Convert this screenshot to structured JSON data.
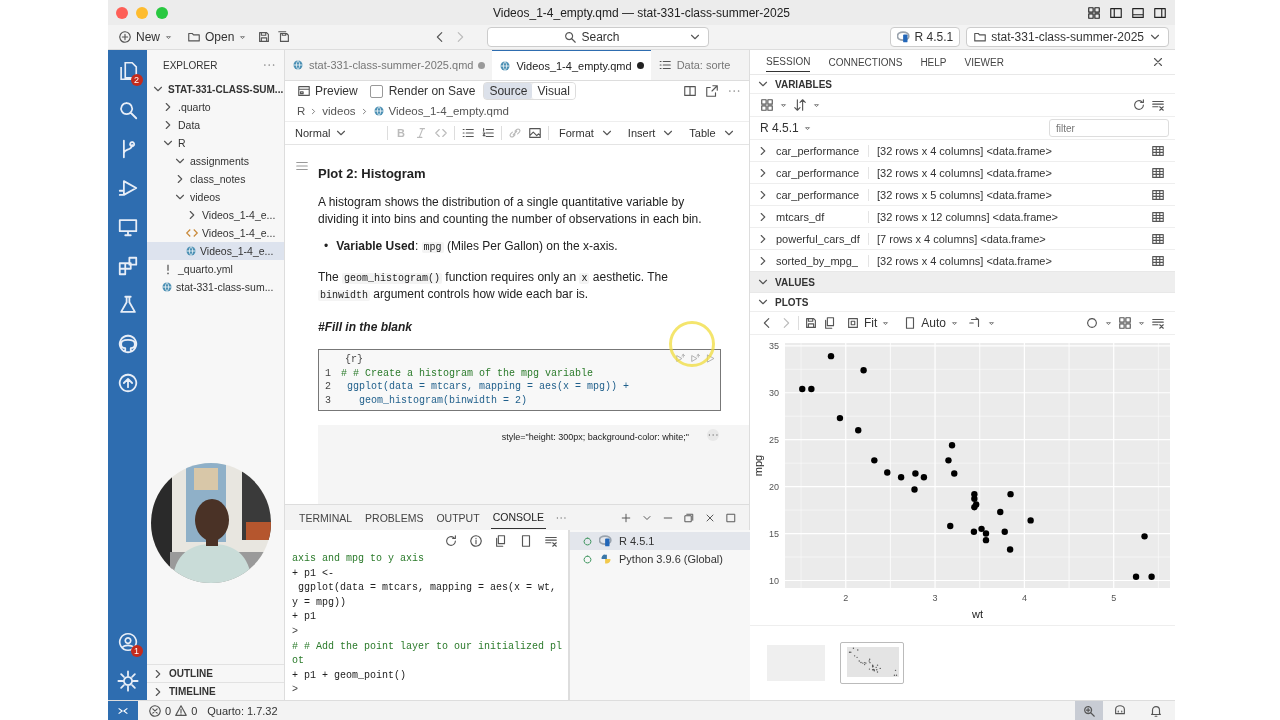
{
  "window": {
    "title": "Videos_1-4_empty.qmd — stat-331-class-summer-2025"
  },
  "toolbar": {
    "new": "New",
    "open": "Open",
    "search": "Search",
    "interpreter": "R 4.5.1",
    "project": "stat-331-class-summer-2025"
  },
  "activity_bar": {
    "explorer_badge": "2",
    "accounts_badge": "1"
  },
  "explorer": {
    "title": "EXPLORER",
    "root": "STAT-331-CLASS-SUM...",
    "tree": [
      {
        "label": ".quarto",
        "kind": "folder",
        "expanded": false,
        "selected": false
      },
      {
        "label": "Data",
        "kind": "folder",
        "expanded": false,
        "selected": false
      },
      {
        "label": "R",
        "kind": "folder",
        "expanded": true,
        "selected": false,
        "children": [
          {
            "label": "assignments",
            "kind": "folder",
            "expanded": true,
            "selected": false
          },
          {
            "label": "class_notes",
            "kind": "folder",
            "expanded": false,
            "selected": false
          },
          {
            "label": "videos",
            "kind": "folder",
            "expanded": true,
            "selected": false,
            "children": [
              {
                "label": "Videos_1-4_e...",
                "kind": "folder",
                "expanded": false,
                "selected": false
              },
              {
                "label": "Videos_1-4_e...",
                "kind": "html",
                "selected": false
              },
              {
                "label": "Videos_1-4_e...",
                "kind": "qmd",
                "selected": true
              }
            ]
          }
        ]
      },
      {
        "label": "_quarto.yml",
        "kind": "yaml",
        "selected": false
      },
      {
        "label": "stat-331-class-sum...",
        "kind": "qmd",
        "selected": false
      }
    ],
    "outline": "OUTLINE",
    "timeline": "TIMELINE"
  },
  "editor": {
    "tabs": [
      {
        "label": "stat-331-class-summer-2025.qmd",
        "kind": "qmd",
        "selected": false,
        "modified": true
      },
      {
        "label": "Videos_1-4_empty.qmd",
        "kind": "qmd",
        "selected": true,
        "modified": true
      },
      {
        "label": "Data: sorte",
        "kind": "data",
        "selected": false,
        "modified": false
      }
    ],
    "preview": "Preview",
    "render_on_save": {
      "label": "Render on Save",
      "checked": false
    },
    "modes": [
      {
        "label": "Source",
        "selected": true
      },
      {
        "label": "Visual",
        "selected": false
      }
    ],
    "breadcrumb": [
      "R",
      "videos",
      "Videos_1-4_empty.qmd"
    ],
    "format": {
      "style": "Normal",
      "bold": "B",
      "menus": [
        "Format",
        "Insert",
        "Table"
      ]
    }
  },
  "document": {
    "heading": "Plot 2: Histogram",
    "paragraph_1": [
      {
        "kind": "text",
        "text": "A histogram shows the distribution of a single quantitative variable by dividing it into bins and counting the number of observations in each bin."
      }
    ],
    "bullet_marker": "•",
    "bullet": [
      {
        "kind": "bold",
        "text": "Variable Used"
      },
      {
        "kind": "text",
        "text": ": "
      },
      {
        "kind": "code",
        "text": "mpg"
      },
      {
        "kind": "text",
        "text": " (Miles Per Gallon) on the x-axis."
      }
    ],
    "paragraph_2": [
      {
        "kind": "text",
        "text": "The "
      },
      {
        "kind": "code",
        "text": "geom_histogram()"
      },
      {
        "kind": "text",
        "text": " function requires only an "
      },
      {
        "kind": "code",
        "text": "x"
      },
      {
        "kind": "text",
        "text": " aesthetic. The "
      },
      {
        "kind": "code",
        "text": "binwidth"
      },
      {
        "kind": "text",
        "text": " argument controls how wide each bar is."
      }
    ],
    "fill_in": "#Fill in the blank",
    "chunk": {
      "header": "{r}",
      "lines": [
        {
          "number": "1",
          "kind": "comment",
          "code": "# # Create a histogram of the mpg variable"
        },
        {
          "number": "2",
          "kind": "code",
          "code": " ggplot(data = mtcars, mapping = aes(x = mpg)) +"
        },
        {
          "number": "3",
          "kind": "code",
          "code": "   geom_histogram(binwidth = 2)"
        }
      ]
    },
    "output_options": "style=\"height: 300px; background-color: white;\""
  },
  "panel": {
    "tabs": [
      {
        "label": "TERMINAL",
        "selected": false
      },
      {
        "label": "PROBLEMS",
        "selected": false
      },
      {
        "label": "OUTPUT",
        "selected": false
      },
      {
        "label": "CONSOLE",
        "selected": true
      }
    ],
    "console": [
      {
        "kind": "comment",
        "text": "axis and mpg to y axis"
      },
      {
        "kind": "input",
        "text": "+ p1 <-"
      },
      {
        "kind": "input",
        "text": " ggplot(data = mtcars, mapping = aes(x = wt,"
      },
      {
        "kind": "input",
        "text": "y = mpg))"
      },
      {
        "kind": "input",
        "text": "+ p1"
      },
      {
        "kind": "prompt",
        "text": ">"
      },
      {
        "kind": "comment",
        "text": "# # Add the point layer to our initialized pl"
      },
      {
        "kind": "comment",
        "text": "ot"
      },
      {
        "kind": "input",
        "text": "+ p1 + geom_point()"
      },
      {
        "kind": "prompt",
        "text": ">"
      }
    ],
    "sessions": [
      {
        "label": "R 4.5.1",
        "kind": "r",
        "selected": true
      },
      {
        "label": "Python 3.9.6 (Global)",
        "kind": "python",
        "selected": false
      }
    ]
  },
  "session": {
    "tabs": [
      {
        "label": "SESSION",
        "selected": true
      },
      {
        "label": "CONNECTIONS",
        "selected": false
      },
      {
        "label": "HELP",
        "selected": false
      },
      {
        "label": "VIEWER",
        "selected": false
      }
    ],
    "variables": {
      "title": "VARIABLES",
      "expanded": true,
      "environment": "R 4.5.1",
      "filter_placeholder": "filter",
      "rows": [
        {
          "name": "car_performance",
          "value": "[32 rows x 4 columns] <data.frame>"
        },
        {
          "name": "car_performance",
          "value": "[32 rows x 4 columns] <data.frame>"
        },
        {
          "name": "car_performance",
          "value": "[32 rows x 5 columns] <data.frame>"
        },
        {
          "name": "mtcars_df",
          "value": "[32 rows x 12 columns] <data.frame>"
        },
        {
          "name": "powerful_cars_df",
          "value": "[7 rows x 4 columns] <data.frame>"
        },
        {
          "name": "sorted_by_mpg_",
          "value": "[32 rows x 4 columns] <data.frame>"
        }
      ]
    },
    "values": {
      "title": "VALUES",
      "expanded": true
    },
    "plots": {
      "title": "PLOTS",
      "expanded": true,
      "fit": "Fit",
      "auto": "Auto",
      "chart_data": {
        "type": "scatter",
        "xlabel": "wt",
        "ylabel": "mpg",
        "xlim": [
          1.32,
          5.63
        ],
        "ylim": [
          9.2,
          35.3
        ],
        "grid": true,
        "xticks": [
          2,
          3,
          4,
          5
        ],
        "yticks": [
          10,
          15,
          20,
          25,
          30,
          35
        ],
        "x": [
          2.62,
          2.875,
          2.32,
          3.215,
          3.44,
          3.46,
          3.57,
          3.19,
          3.15,
          3.44,
          3.44,
          4.07,
          3.73,
          3.78,
          5.25,
          5.424,
          5.345,
          2.2,
          1.615,
          1.835,
          2.465,
          3.52,
          3.435,
          3.84,
          3.845,
          1.935,
          2.14,
          1.513,
          3.17,
          2.77,
          3.57,
          2.78
        ],
        "series": [
          {
            "color": "#000000",
            "values": [
              21,
              21,
              22.8,
              21.4,
              18.7,
              18.1,
              14.3,
              24.4,
              22.8,
              19.2,
              17.8,
              16.4,
              17.3,
              15.2,
              10.4,
              10.4,
              14.7,
              32.4,
              30.4,
              33.9,
              21.5,
              15.5,
              15.2,
              13.3,
              19.2,
              27.3,
              26,
              30.4,
              15.8,
              19.7,
              15,
              21.4
            ]
          }
        ]
      },
      "thumbnails": [
        {
          "kind": "blank",
          "selected": false
        },
        {
          "kind": "scatter",
          "selected": true
        }
      ]
    }
  },
  "status_bar": {
    "errors": "0",
    "warnings": "0",
    "quarto": "Quarto: 1.7.32"
  }
}
